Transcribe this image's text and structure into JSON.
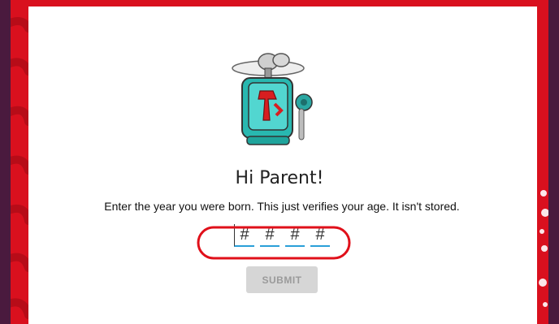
{
  "dialog": {
    "title": "Hi Parent!",
    "instructions": "Enter the year you were born. This just verifies your age. It isn't stored.",
    "year_inputs": [
      {
        "placeholder": "#",
        "value": ""
      },
      {
        "placeholder": "#",
        "value": ""
      },
      {
        "placeholder": "#",
        "value": ""
      },
      {
        "placeholder": "#",
        "value": ""
      }
    ],
    "submit_label": "SUBMIT",
    "mascot_icon": "robot-mascot-icon"
  },
  "colors": {
    "frame_red": "#d9101e",
    "outer_bg": "#4a1a3e",
    "input_underline": "#2a9fd8",
    "submit_disabled_bg": "#d6d6d6",
    "annotation_red": "#e0101a"
  }
}
